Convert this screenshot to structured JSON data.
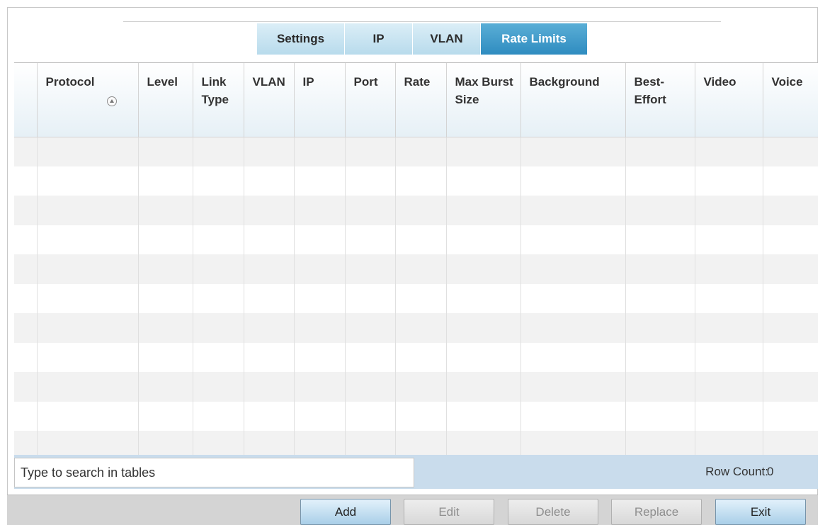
{
  "tabs": [
    {
      "label": "Settings",
      "active": false
    },
    {
      "label": "IP",
      "active": false
    },
    {
      "label": "VLAN",
      "active": false
    },
    {
      "label": "Rate Limits",
      "active": true
    }
  ],
  "table": {
    "columns": [
      {
        "label": "Protocol",
        "sortable": true
      },
      {
        "label": "Level"
      },
      {
        "label": "Link Type"
      },
      {
        "label": "VLAN"
      },
      {
        "label": "IP"
      },
      {
        "label": "Port"
      },
      {
        "label": "Rate"
      },
      {
        "label": "Max Burst Size"
      },
      {
        "label": "Background"
      },
      {
        "label": "Best-Effort"
      },
      {
        "label": "Video"
      },
      {
        "label": "Voice"
      }
    ],
    "rows": []
  },
  "search": {
    "placeholder": "Type to search in tables",
    "value": ""
  },
  "row_count": {
    "label": "Row Count:",
    "value": "0"
  },
  "buttons": {
    "add": "Add",
    "edit": "Edit",
    "delete": "Delete",
    "replace": "Replace",
    "exit": "Exit"
  },
  "colors": {
    "active_tab": "#3b97c9",
    "inactive_tab": "#c6e3f1",
    "search_bar": "#c9dcec",
    "button_bar": "#d4d4d4"
  }
}
